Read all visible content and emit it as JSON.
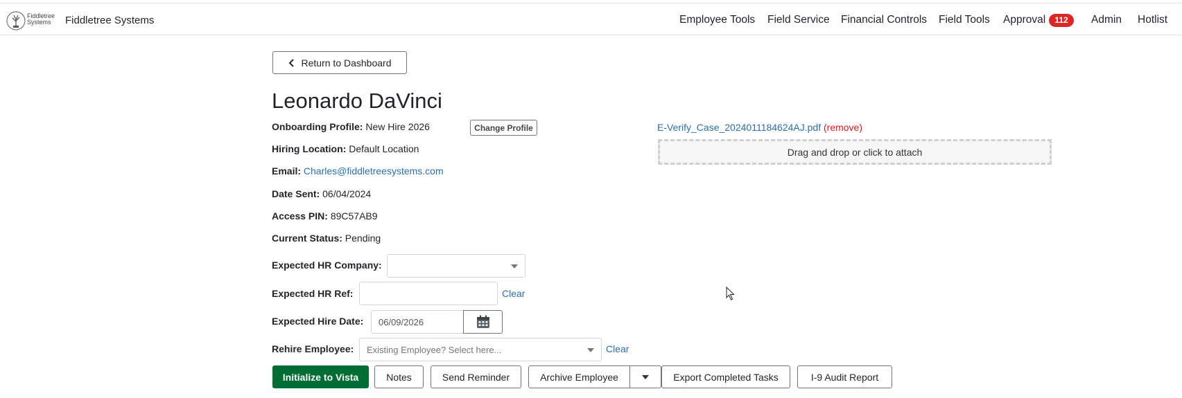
{
  "brand": {
    "logo_line1": "Fiddletree",
    "logo_line2": "Systems",
    "name": "Fiddletree Systems"
  },
  "nav": {
    "employee_tools": "Employee Tools",
    "field_service": "Field Service",
    "financial_controls": "Financial Controls",
    "field_tools": "Field Tools",
    "approval": "Approval",
    "approval_count": "112",
    "admin": "Admin",
    "hotlist": "Hotlist"
  },
  "back_button": "Return to Dashboard",
  "employee_name": "Leonardo DaVinci",
  "profile": {
    "onboarding_label": "Onboarding Profile:",
    "onboarding_value": "New Hire 2026",
    "change_profile": "Change Profile",
    "hiring_location_label": "Hiring Location:",
    "hiring_location_value": "Default Location",
    "email_label": "Email:",
    "email_value": "Charles@fiddletreesystems.com",
    "date_sent_label": "Date Sent:",
    "date_sent_value": "06/04/2024",
    "access_pin_label": "Access PIN:",
    "access_pin_value": "89C57AB9",
    "status_label": "Current Status:",
    "status_value": "Pending"
  },
  "form": {
    "hr_company_label": "Expected HR Company:",
    "hr_company_value": "",
    "hr_ref_label": "Expected HR Ref:",
    "hr_ref_value": "",
    "hr_ref_clear": "Clear",
    "hire_date_label": "Expected Hire Date:",
    "hire_date_value": "06/09/2026",
    "rehire_label": "Rehire Employee:",
    "rehire_placeholder": "Existing Employee? Select here...",
    "rehire_clear": "Clear"
  },
  "attachments": {
    "file_name": "E-Verify_Case_2024011184624AJ.pdf",
    "remove": "(remove)",
    "dropzone": "Drag and drop or click to attach"
  },
  "actions": {
    "initialize": "Initialize to Vista",
    "notes": "Notes",
    "send_reminder": "Send Reminder",
    "archive": "Archive Employee",
    "export": "Export Completed Tasks",
    "i9_audit": "I-9 Audit Report"
  },
  "colors": {
    "primary_green": "#006d32",
    "link_blue": "#2a6fb6",
    "badge_red": "#dc2626",
    "remove_red": "#e3141c"
  }
}
